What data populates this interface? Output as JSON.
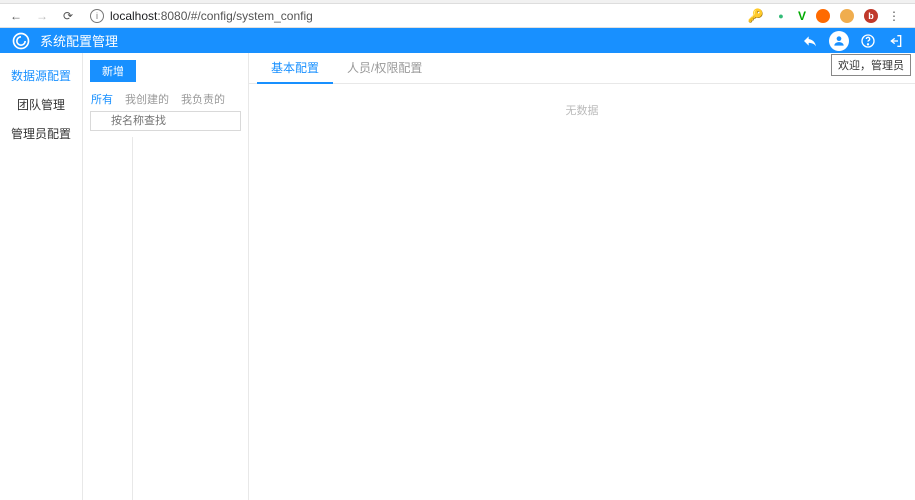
{
  "browser": {
    "url_host": "localhost",
    "url_port": ":8080",
    "url_path": "/#/config/system_config"
  },
  "header": {
    "title": "系统配置管理",
    "welcome_tooltip": "欢迎，管理员"
  },
  "sidebar": {
    "items": [
      {
        "label": "数据源配置",
        "active": true
      },
      {
        "label": "团队管理",
        "active": false
      },
      {
        "label": "管理员配置",
        "active": false
      }
    ]
  },
  "midpane": {
    "add_button": "新增",
    "filters": [
      {
        "label": "所有",
        "active": true
      },
      {
        "label": "我创建的",
        "active": false
      },
      {
        "label": "我负责的",
        "active": false
      }
    ],
    "search_placeholder": "按名称查找"
  },
  "content": {
    "tabs": [
      {
        "label": "基本配置",
        "active": true
      },
      {
        "label": "人员/权限配置",
        "active": false
      }
    ],
    "empty_text": "无数据"
  }
}
